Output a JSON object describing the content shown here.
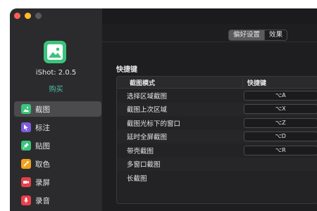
{
  "sidebar": {
    "app_name": "iShot: 2.0.5",
    "buy_label": "购买",
    "items": [
      {
        "label": "截图",
        "color": "#3bc47c"
      },
      {
        "label": "标注",
        "color": "#7c5ce0"
      },
      {
        "label": "贴图",
        "color": "#3bc47c"
      },
      {
        "label": "取色",
        "color": "#f0a21b"
      },
      {
        "label": "录屏",
        "color": "#e8404a"
      },
      {
        "label": "录音",
        "color": "#e8404a"
      }
    ]
  },
  "tabs": [
    "偏好设置",
    "效果"
  ],
  "section_title": "快捷键",
  "table": {
    "headers": [
      "截图模式",
      "快捷键"
    ],
    "rows": [
      {
        "mode": "选择区域截图",
        "shortcut": "⌥A"
      },
      {
        "mode": "截图上次区域",
        "shortcut": "⌥X"
      },
      {
        "mode": "截图光标下的窗口",
        "shortcut": "⌥Z"
      },
      {
        "mode": "延时全屏截图",
        "shortcut": "⌥D"
      },
      {
        "mode": "带壳截图",
        "shortcut": "⌥R"
      },
      {
        "mode": "多窗口截图",
        "shortcut": ""
      },
      {
        "mode": "长截图",
        "shortcut": ""
      }
    ]
  }
}
